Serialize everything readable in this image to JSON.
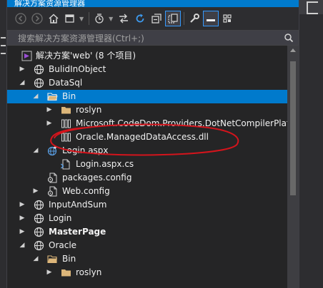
{
  "window": {
    "title": "解决方案资源管理器"
  },
  "toolbar": {
    "buttons": [
      "back-icon",
      "forward-icon",
      "home-icon",
      "switch-views-icon",
      "pending-changes-filter-icon",
      "sync-with-active-document-icon",
      "refresh-icon",
      "collapse-all-icon",
      "show-all-files-icon",
      "properties-icon",
      "preview-selected-items-icon",
      "settings-icon"
    ]
  },
  "search": {
    "placeholder": "搜索解决方案资源管理器(Ctrl+;)"
  },
  "tree": {
    "solution": "解决方案'web' (8 个项目)",
    "items": [
      {
        "label": "BulidInObject",
        "icon": "web-project-icon"
      },
      {
        "label": "DataSql",
        "icon": "web-project-icon"
      },
      {
        "label": "Bin",
        "icon": "folder-open-icon"
      },
      {
        "label": "roslyn",
        "icon": "folder-icon"
      },
      {
        "label": "Microsoft.CodeDom.Providers.DotNetCompilerPlatform.dll",
        "icon": "dll-icon"
      },
      {
        "label": "Oracle.ManagedDataAccess.dll",
        "icon": "dll-icon"
      },
      {
        "label": "Login.aspx",
        "icon": "aspx-icon"
      },
      {
        "label": "Login.aspx.cs",
        "icon": "cs-file-icon"
      },
      {
        "label": "packages.config",
        "icon": "config-file-icon"
      },
      {
        "label": "Web.config",
        "icon": "config-file-icon"
      },
      {
        "label": "InputAndSum",
        "icon": "web-project-icon"
      },
      {
        "label": "Login",
        "icon": "web-project-icon"
      },
      {
        "label": "MasterPage",
        "icon": "web-project-icon"
      },
      {
        "label": "Oracle",
        "icon": "web-project-icon"
      },
      {
        "label": "Bin",
        "icon": "folder-open-icon"
      },
      {
        "label": "roslyn",
        "icon": "folder-icon"
      }
    ]
  },
  "colors": {
    "accent": "#007acc",
    "background": "#252526",
    "text": "#f1f1f1",
    "annotation": "#d4141c",
    "folder": "#dcb67a"
  }
}
